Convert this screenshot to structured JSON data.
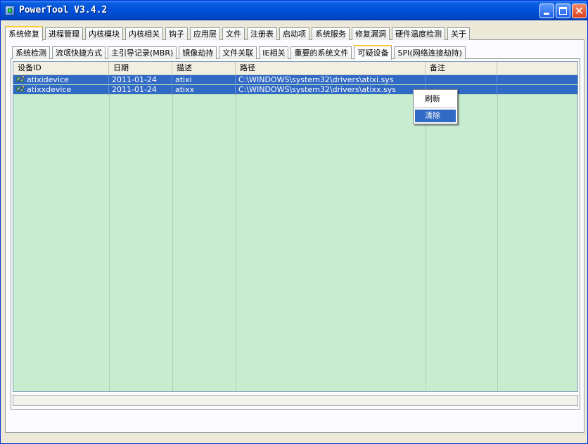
{
  "window": {
    "title": "PowerTool V3.4.2"
  },
  "main_tabs": [
    "系统修复",
    "进程管理",
    "内核模块",
    "内核相关",
    "钩子",
    "应用层",
    "文件",
    "注册表",
    "启动项",
    "系统服务",
    "修复漏洞",
    "硬件温度检测",
    "关于"
  ],
  "sub_tabs": [
    "系统检测",
    "流氓快捷方式",
    "主引导记录(MBR)",
    "镜像劫持",
    "文件关联",
    "IE相关",
    "重要的系统文件",
    "可疑设备",
    "SPI(网络连接劫持)"
  ],
  "columns": [
    "设备ID",
    "日期",
    "描述",
    "路径",
    "备注"
  ],
  "rows": [
    {
      "id": "atixidevice",
      "date": "2011-01-24",
      "desc": "atixi",
      "path": "C:\\WINDOWS\\system32\\drivers\\atixi.sys",
      "note": ""
    },
    {
      "id": "atixxdevice",
      "date": "2011-01-24",
      "desc": "atixx",
      "path": "C:\\WINDOWS\\system32\\drivers\\atixx.sys",
      "note": ""
    }
  ],
  "context_menu": {
    "refresh": "刷新",
    "clear": "清除"
  },
  "colors": {
    "titlebar": "#0050d8",
    "list_bg": "#c8ecd0",
    "selection": "#316ac5",
    "tab_highlight": "#ffc83c"
  }
}
